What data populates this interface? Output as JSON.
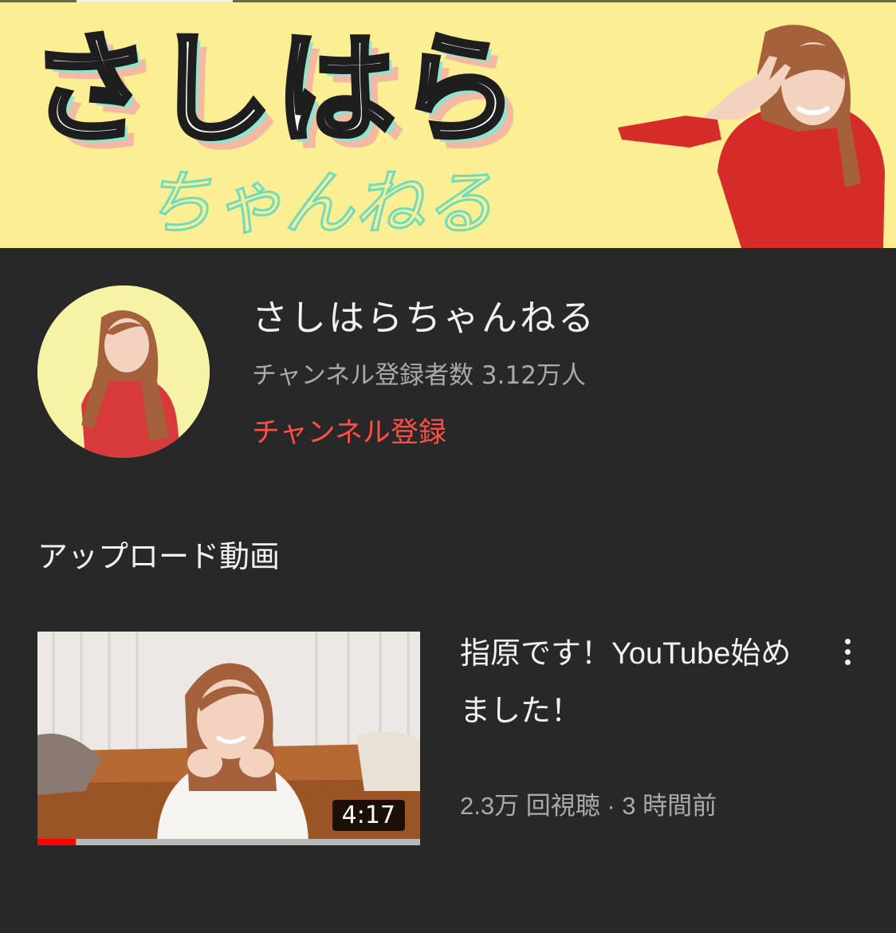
{
  "banner": {
    "logo_text": "さしはら",
    "logo_script": "ちゃんねる"
  },
  "channel": {
    "name": "さしはらちゃんねる",
    "subscriber_count": "チャンネル登録者数 3.12万人",
    "subscribe_label": "チャンネル登録"
  },
  "uploads": {
    "section_title": "アップロード動画",
    "videos": [
      {
        "title": "指原です！YouTube始めました！",
        "meta": "2.3万 回視聴 · 3 時間前",
        "duration": "4:17",
        "watched_fraction": 0.1
      }
    ]
  },
  "colors": {
    "background": "#282828",
    "banner_yellow": "#fbee93",
    "subscribe_red": "#ff4e45",
    "progress_red": "#ff0000"
  },
  "icons": {
    "more": "more-vert-icon"
  }
}
